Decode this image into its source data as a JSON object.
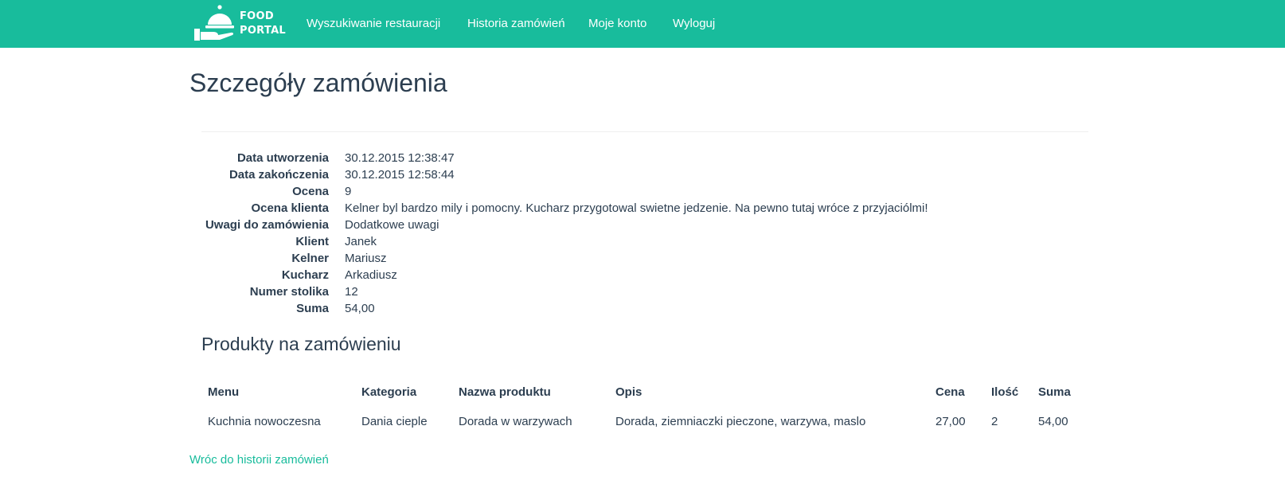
{
  "brand": {
    "line1": "FOOD",
    "line2": "PORTAL",
    "icon": "cloche-serving-icon"
  },
  "nav": {
    "items": [
      {
        "label": "Wyszukiwanie restauracji"
      },
      {
        "label": "Historia zamówień"
      },
      {
        "label": "Moje konto"
      },
      {
        "label": "Wyloguj"
      }
    ]
  },
  "page": {
    "title": "Szczegóły zamówienia"
  },
  "details": [
    {
      "label": "Data utworzenia",
      "value": "30.12.2015 12:38:47"
    },
    {
      "label": "Data zakończenia",
      "value": "30.12.2015 12:58:44"
    },
    {
      "label": "Ocena",
      "value": "9"
    },
    {
      "label": "Ocena klienta",
      "value": "Kelner byl bardzo mily i pomocny. Kucharz przygotowal swietne jedzenie. Na pewno tutaj wróce z przyjaciólmi!"
    },
    {
      "label": "Uwagi do zamówienia",
      "value": "Dodatkowe uwagi"
    },
    {
      "label": "Klient",
      "value": "Janek"
    },
    {
      "label": "Kelner",
      "value": "Mariusz"
    },
    {
      "label": "Kucharz",
      "value": "Arkadiusz"
    },
    {
      "label": "Numer stolika",
      "value": "12"
    },
    {
      "label": "Suma",
      "value": "54,00"
    }
  ],
  "products": {
    "title": "Produkty na zamówieniu",
    "columns": [
      "Menu",
      "Kategoria",
      "Nazwa produktu",
      "Opis",
      "Cena",
      "Ilość",
      "Suma"
    ],
    "rows": [
      [
        "Kuchnia nowoczesna",
        "Dania cieple",
        "Dorada w warzywach",
        "Dorada, ziemniaczki pieczone, warzywa, maslo",
        "27,00",
        "2",
        "54,00"
      ]
    ]
  },
  "back_link": "Wróc do historii zamówień",
  "colors": {
    "navbar": "#18bc9c",
    "text": "#2c3e50",
    "link": "#18bc9c"
  }
}
